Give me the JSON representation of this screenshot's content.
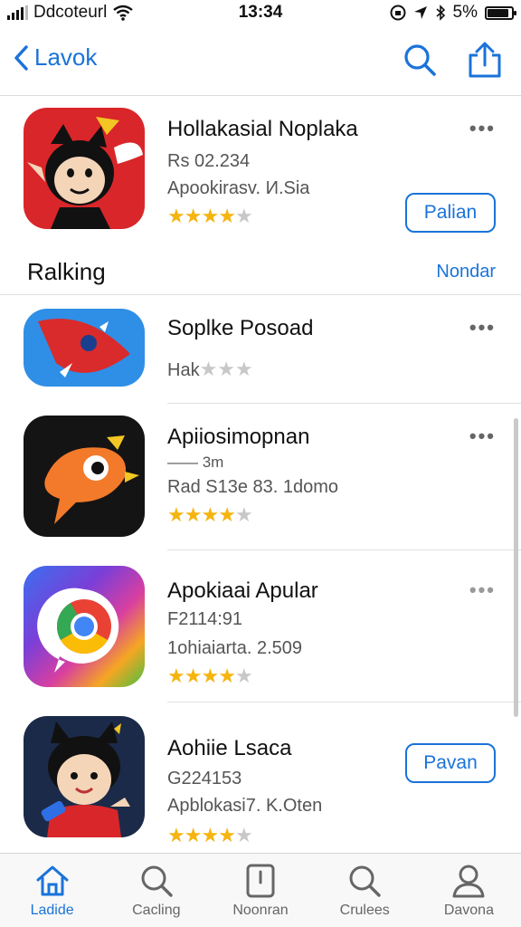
{
  "status_bar": {
    "carrier": "Ddcoteurl",
    "time": "13:34",
    "battery": "5%",
    "battery_level": 0.9
  },
  "nav": {
    "back_label": "Lavok",
    "search_icon": "search-icon",
    "share_icon": "share-icon"
  },
  "section": {
    "title": "Ralking",
    "link": "Nondar"
  },
  "apps": [
    {
      "name": "Hollakasial Noplaka",
      "line1": "Rs 02.234",
      "line2": "Apookirasv. И.Sia",
      "rating": 4,
      "action": "Palian"
    },
    {
      "name": "Soplke Posoad",
      "line1": "Hak",
      "line2": "",
      "rating": 0,
      "action": ""
    },
    {
      "name": "Apiiosimopnan",
      "line1": "—— 3m",
      "line2": "Rad S13e 83. 1domo",
      "rating": 4,
      "action": ""
    },
    {
      "name": "Apokiaai Apular",
      "line1": "F2114:91",
      "line2": "1ohiaiarta. 2.509",
      "rating": 4,
      "action": ""
    },
    {
      "name": "Aohiie Lsaca",
      "line1": "G224153",
      "line2": "Apblokasi7. K.Oten",
      "rating": 4,
      "action": "Pavan"
    }
  ],
  "tabs": [
    {
      "label": "Ladide",
      "icon": "home-icon",
      "active": true
    },
    {
      "label": "Cacling",
      "icon": "search-icon",
      "active": false
    },
    {
      "label": "Noonran",
      "icon": "page-icon",
      "active": false
    },
    {
      "label": "Crulees",
      "icon": "search-icon",
      "active": false
    },
    {
      "label": "Davona",
      "icon": "person-icon",
      "active": false
    }
  ],
  "colors": {
    "accent": "#1a73d9",
    "star": "#f5b40f"
  }
}
